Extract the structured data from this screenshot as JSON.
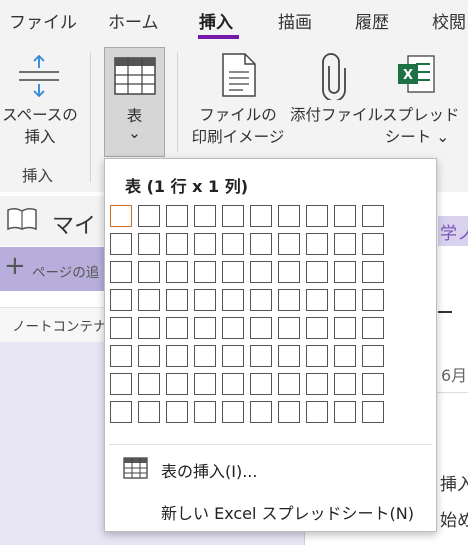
{
  "tabs": [
    {
      "label": "ファイル",
      "active": false
    },
    {
      "label": "ホーム",
      "active": false
    },
    {
      "label": "挿入",
      "active": true
    },
    {
      "label": "描画",
      "active": false
    },
    {
      "label": "履歴",
      "active": false
    },
    {
      "label": "校閲",
      "active": false
    }
  ],
  "ribbon": {
    "space_insert": {
      "line1": "スペースの",
      "line2": "挿入",
      "icon": "space-arrows-icon"
    },
    "table": {
      "label": "表",
      "chevron": "⌄",
      "icon": "table-icon"
    },
    "file_printout": {
      "line1": "ファイルの",
      "line2": "印刷イメージ",
      "icon": "document-icon"
    },
    "attach_file": {
      "label": "添付ファイル",
      "icon": "paperclip-icon"
    },
    "spreadsheet": {
      "line1": "スプレッド",
      "line2": "シート ⌄",
      "icon": "excel-icon"
    },
    "group_insert": "挿入"
  },
  "background": {
    "notebook_title": "マイ",
    "add_page": "ページの追",
    "add_plus": "+",
    "container_label": "ノートコンテナ",
    "right_tab": "学ノ",
    "date": "6月",
    "line1": "挿入",
    "line2": "始め"
  },
  "dropdown": {
    "header": "表 (1 行 x 1 列)",
    "grid": {
      "rows": 8,
      "cols": 10,
      "selected_rows": 1,
      "selected_cols": 1
    },
    "items": [
      {
        "label": "表の挿入(I)...",
        "icon": "table-insert-icon"
      },
      {
        "label": "新しい Excel スプレッドシート(N)",
        "icon": ""
      }
    ]
  },
  "colors": {
    "accent": "#7719aa",
    "selected_cell": "#d2691e",
    "excel_green": "#1e7145",
    "icon_blue": "#2b88d8"
  }
}
